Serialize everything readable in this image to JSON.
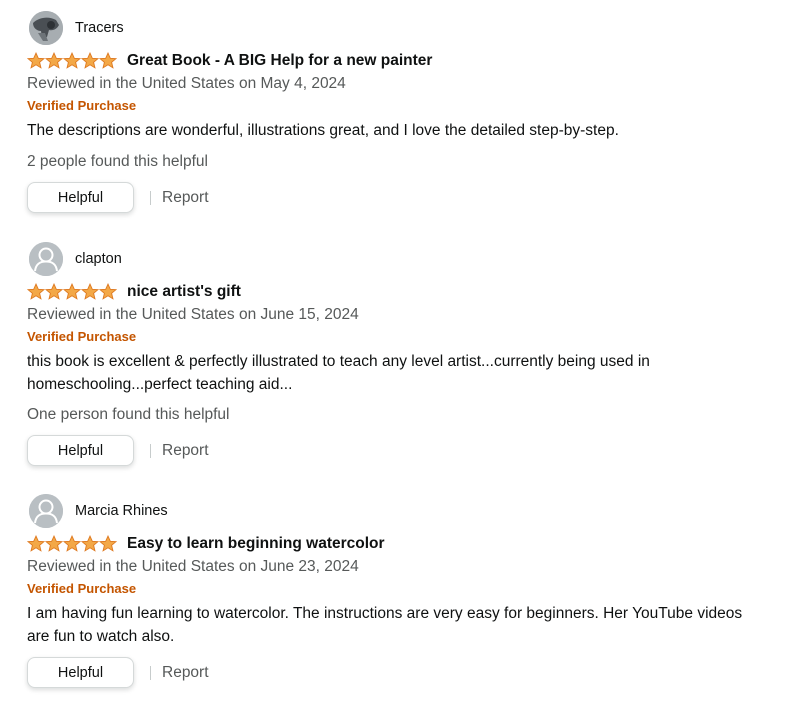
{
  "colors": {
    "star": "#f3a847",
    "star_outline": "#de7921",
    "verified": "#c45500",
    "secondary_text": "#565959",
    "primary_text": "#0f1111"
  },
  "reviews": [
    {
      "profile_name": "Tracers",
      "avatar": "photo-avatar-icon",
      "rating": 5,
      "title": "Great Book - A BIG Help for a new painter",
      "date": "Reviewed in the United States on May 4, 2024",
      "verified": "Verified Purchase",
      "body": "The descriptions are wonderful, illustrations great, and I love the detailed step-by-step.",
      "helpful_count": "2 people found this helpful",
      "helpful_label": "Helpful",
      "report_label": "Report"
    },
    {
      "profile_name": "clapton",
      "avatar": "default-avatar-icon",
      "rating": 5,
      "title": "nice artist's gift",
      "date": "Reviewed in the United States on June 15, 2024",
      "verified": "Verified Purchase",
      "body": "this book is excellent & perfectly illustrated to teach any level artist...currently being used in homeschooling...perfect teaching aid...",
      "helpful_count": "One person found this helpful",
      "helpful_label": "Helpful",
      "report_label": "Report"
    },
    {
      "profile_name": "Marcia Rhines",
      "avatar": "default-avatar-icon",
      "rating": 5,
      "title": "Easy to learn beginning watercolor",
      "date": "Reviewed in the United States on June 23, 2024",
      "verified": "Verified Purchase",
      "body": "I am having fun learning to watercolor. The instructions are very easy for beginners. Her YouTube videos are fun to watch also.",
      "helpful_count": "",
      "helpful_label": "Helpful",
      "report_label": "Report"
    }
  ]
}
